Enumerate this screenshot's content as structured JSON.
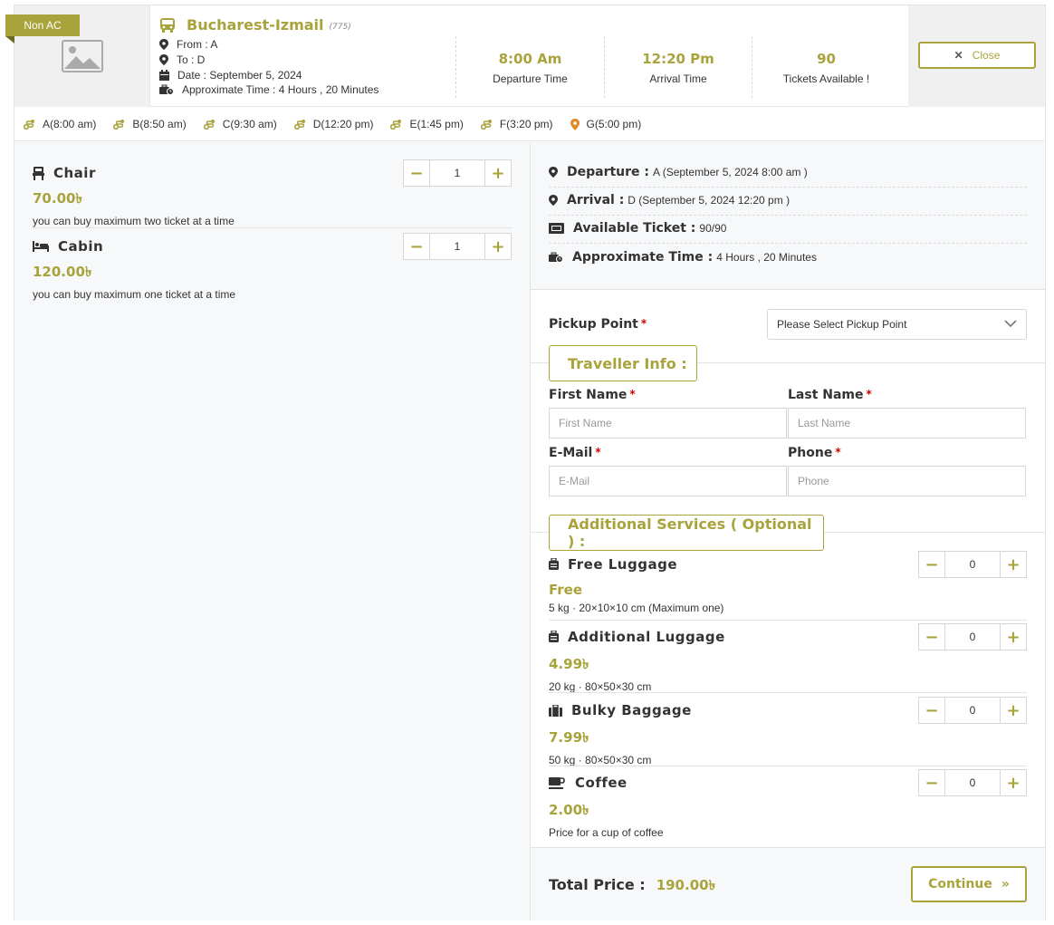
{
  "header": {
    "ribbon": "Non AC",
    "route_name": "Bucharest-Izmail",
    "route_number": "(775)",
    "from": "From : A",
    "to": "To : D",
    "date": "Date : September 5, 2024",
    "approx_time": "Approximate Time : 4 Hours , 20 Minutes",
    "departure_time": "8:00 Am",
    "departure_label": "Departure Time",
    "arrival_time": "12:20 Pm",
    "arrival_label": "Arrival Time",
    "tickets_available": "90",
    "tickets_label": "Tickets Available !",
    "close_label": "Close"
  },
  "stops": [
    {
      "label": "A(8:00 am)",
      "icon": "route-icon"
    },
    {
      "label": "B(8:50 am)",
      "icon": "route-icon"
    },
    {
      "label": "C(9:30 am)",
      "icon": "route-icon"
    },
    {
      "label": "D(12:20 pm)",
      "icon": "route-icon"
    },
    {
      "label": "E(1:45 pm)",
      "icon": "route-icon"
    },
    {
      "label": "F(3:20 pm)",
      "icon": "route-icon"
    },
    {
      "label": "G(5:00 pm)",
      "icon": "map-marker-icon"
    }
  ],
  "seats": [
    {
      "name": "Chair",
      "price": "70.00৳",
      "note": "you can buy maximum two ticket at a time",
      "qty": "1",
      "icon": "chair-icon"
    },
    {
      "name": "Cabin",
      "price": "120.00৳",
      "note": "you can buy maximum one ticket at a time",
      "qty": "1",
      "icon": "bed-icon"
    }
  ],
  "summary": {
    "departure_key": "Departure :",
    "departure_val": "A (September 5, 2024 8:00 am )",
    "arrival_key": "Arrival :",
    "arrival_val": "D (September 5, 2024 12:20 pm )",
    "available_key": "Available Ticket :",
    "available_val": "90/90",
    "approx_key": "Approximate Time :",
    "approx_val": "4 Hours , 20 Minutes"
  },
  "pickup": {
    "label": "Pickup Point",
    "required": "*",
    "placeholder": "Please Select Pickup Point"
  },
  "traveller": {
    "legend": "Traveller Info :",
    "first_name_label": "First Name",
    "first_name_placeholder": "First Name",
    "last_name_label": "Last Name",
    "last_name_placeholder": "Last Name",
    "email_label": "E-Mail",
    "email_placeholder": "E-Mail",
    "phone_label": "Phone",
    "phone_placeholder": "Phone",
    "required": "*"
  },
  "services": {
    "legend": "Additional Services ( Optional ) :",
    "items": [
      {
        "name": "Free Luggage",
        "price": "Free",
        "note": "5 kg · 20×10×10 cm (Maximum one)",
        "qty": "0",
        "icon": "luggage-icon"
      },
      {
        "name": "Additional Luggage",
        "price": "4.99৳",
        "note": "20 kg · 80×50×30 cm",
        "qty": "0",
        "icon": "luggage-icon"
      },
      {
        "name": "Bulky Baggage",
        "price": "7.99৳",
        "note": "50 kg · 80×50×30 cm",
        "qty": "0",
        "icon": "suitcase-icon"
      },
      {
        "name": "Coffee",
        "price": "2.00৳",
        "note": "Price for a cup of coffee",
        "qty": "0",
        "icon": "coffee-icon"
      }
    ]
  },
  "footer": {
    "total_label": "Total Price :",
    "total_value": "190.00৳",
    "continue_label": "Continue"
  },
  "colors": {
    "accent": "#a9a33c",
    "panel_bg": "#f7f8fa",
    "border": "#e3e3e3"
  }
}
